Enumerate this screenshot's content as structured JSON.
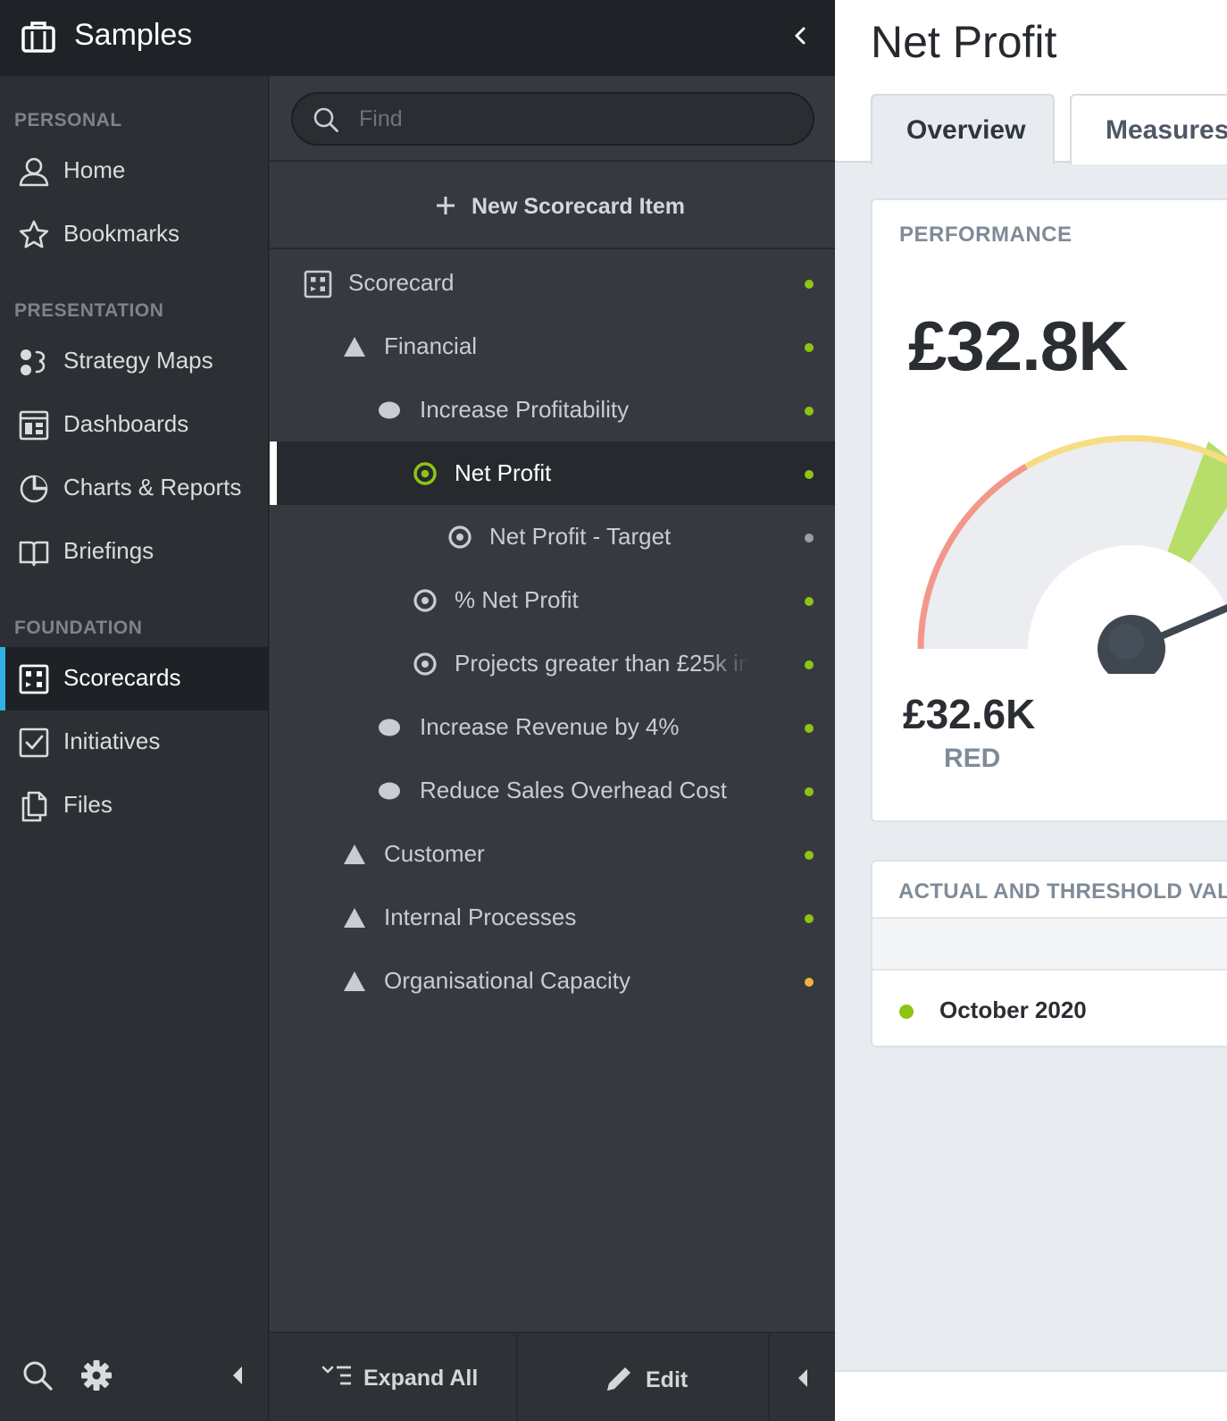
{
  "app": {
    "title": "Samples",
    "icon": "briefcase-icon"
  },
  "nav": {
    "sections": [
      {
        "label": "PERSONAL"
      },
      {
        "label": "PRESENTATION"
      },
      {
        "label": "FOUNDATION"
      }
    ],
    "items": [
      {
        "label": "Home",
        "icon": "user-icon"
      },
      {
        "label": "Bookmarks",
        "icon": "star-icon"
      },
      {
        "label": "Strategy Maps",
        "icon": "strategy-map-icon"
      },
      {
        "label": "Dashboards",
        "icon": "dashboard-icon"
      },
      {
        "label": "Charts & Reports",
        "icon": "pie-chart-icon"
      },
      {
        "label": "Briefings",
        "icon": "book-icon"
      },
      {
        "label": "Scorecards",
        "icon": "scorecard-icon",
        "active": true
      },
      {
        "label": "Initiatives",
        "icon": "checkbox-icon"
      },
      {
        "label": "Files",
        "icon": "files-icon"
      }
    ]
  },
  "search": {
    "placeholder": "Find",
    "value": ""
  },
  "tree": {
    "new_item_label": "New Scorecard Item",
    "rows": [
      {
        "label": "Scorecard",
        "icon": "scorecard-icon",
        "status": "green"
      },
      {
        "label": "Financial",
        "icon": "triangle-icon",
        "status": "green"
      },
      {
        "label": "Increase Profitability",
        "icon": "ellipse-icon",
        "status": "green"
      },
      {
        "label": "Net Profit",
        "icon": "target-icon",
        "status": "green",
        "selected": true
      },
      {
        "label": "Net Profit - Target",
        "icon": "target-icon",
        "status": "grey"
      },
      {
        "label": "% Net Profit",
        "icon": "target-icon",
        "status": "green"
      },
      {
        "label": "Projects greater than £25k in",
        "icon": "target-icon",
        "status": "green"
      },
      {
        "label": "Increase Revenue by 4%",
        "icon": "ellipse-icon",
        "status": "green"
      },
      {
        "label": "Reduce Sales Overhead Cost",
        "icon": "ellipse-icon",
        "status": "green"
      },
      {
        "label": "Customer",
        "icon": "triangle-icon",
        "status": "green"
      },
      {
        "label": "Internal Processes",
        "icon": "triangle-icon",
        "status": "green"
      },
      {
        "label": "Organisational Capacity",
        "icon": "triangle-icon",
        "status": "yellow"
      }
    ],
    "footer": {
      "expand_label": "Expand All",
      "edit_label": "Edit"
    }
  },
  "colors": {
    "status_green": "#8cc514",
    "status_yellow": "#f3b23c",
    "status_grey": "#9aa0a6",
    "accent_blue": "#2fb2e3",
    "gauge_red": "#f3978a",
    "gauge_yellow": "#f6dd84",
    "gauge_green": "#b7de6a"
  },
  "content": {
    "title": "Net Profit",
    "tabs": [
      {
        "label": "Overview",
        "active": true
      },
      {
        "label": "Measures"
      }
    ],
    "performance": {
      "heading": "PERFORMANCE",
      "value": "£32.8K",
      "previous_value": "£32.6K",
      "previous_status": "RED"
    },
    "threshold": {
      "heading": "ACTUAL AND THRESHOLD VALUES",
      "period": "October 2020",
      "period_status": "green"
    }
  }
}
